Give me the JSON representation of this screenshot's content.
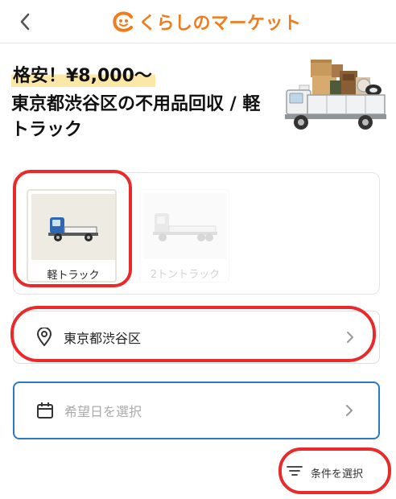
{
  "header": {
    "back_icon": "chevron-left-icon",
    "logo_text": "くらしのマーケット",
    "logo_color": "#f07c1e"
  },
  "hero": {
    "price": "格安！¥8,000〜",
    "title": "東京都渋谷区の不用品回収 / 軽トラック"
  },
  "vehicles": [
    {
      "label": "軽トラック",
      "state": "selected"
    },
    {
      "label": "2トントラック",
      "state": "disabled"
    }
  ],
  "location": {
    "value": "東京都渋谷区",
    "icon": "map-pin-icon"
  },
  "date": {
    "placeholder": "希望日を選択",
    "icon": "calendar-icon"
  },
  "conditions": {
    "label": "条件を選択",
    "icon": "filter-icon"
  },
  "colors": {
    "accent": "#f07c1e",
    "focus_border": "#2b79c2",
    "annotation": "#ea2a2a",
    "price_highlight": "#fbe8a6"
  }
}
